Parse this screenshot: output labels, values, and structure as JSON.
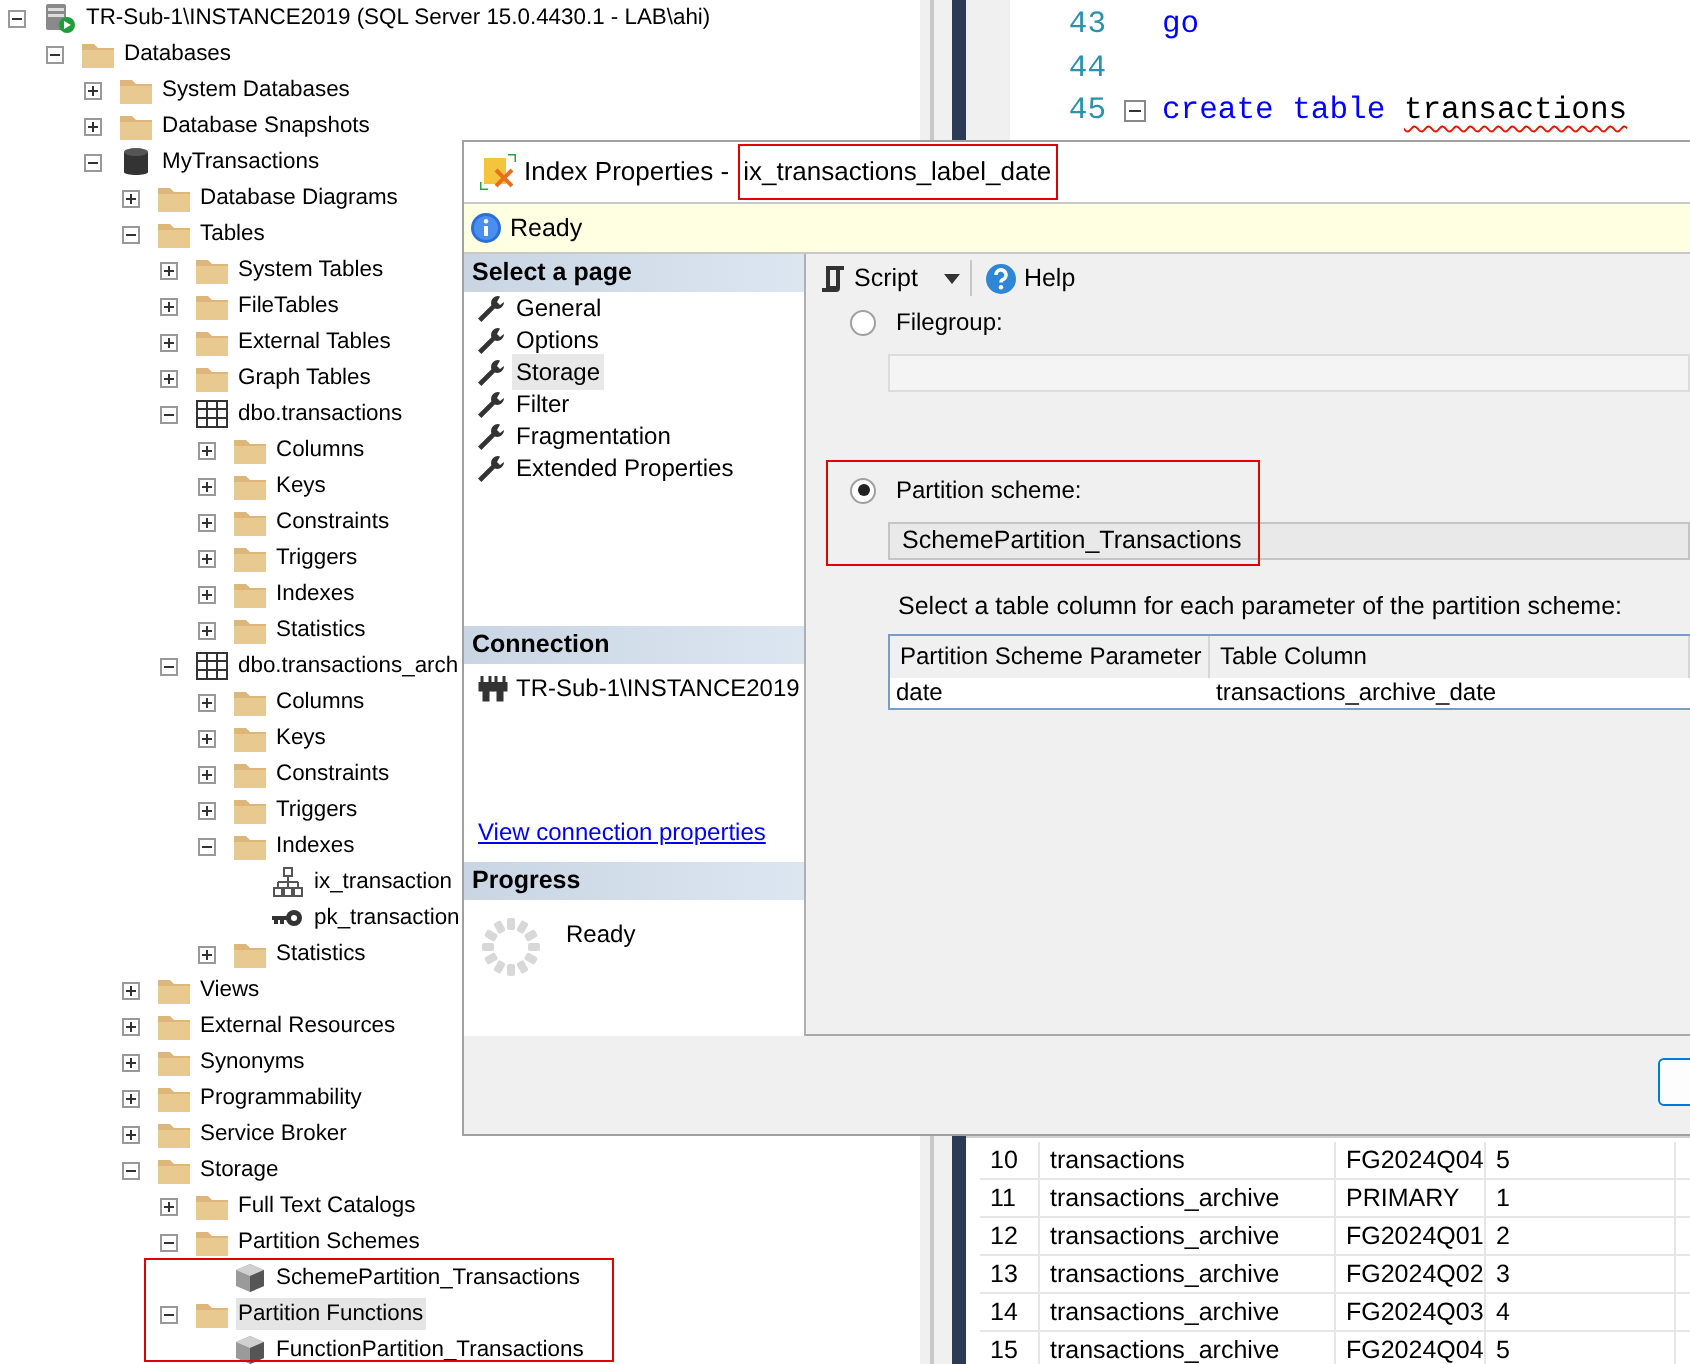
{
  "explorer": {
    "tree": [
      {
        "label": "TR-Sub-1\\INSTANCE2019 (SQL Server 15.0.4430.1 - LAB\\ahi)",
        "kind": "server",
        "expanded": true,
        "children": [
          {
            "label": "Databases",
            "kind": "folder",
            "expanded": true,
            "children": [
              {
                "label": "System Databases",
                "kind": "folder",
                "expanded": false
              },
              {
                "label": "Database Snapshots",
                "kind": "folder",
                "expanded": false
              },
              {
                "label": "MyTransactions",
                "kind": "database",
                "expanded": true,
                "children": [
                  {
                    "label": "Database Diagrams",
                    "kind": "folder",
                    "expanded": false
                  },
                  {
                    "label": "Tables",
                    "kind": "folder",
                    "expanded": true,
                    "children": [
                      {
                        "label": "System Tables",
                        "kind": "folder",
                        "expanded": false
                      },
                      {
                        "label": "FileTables",
                        "kind": "folder",
                        "expanded": false
                      },
                      {
                        "label": "External Tables",
                        "kind": "folder",
                        "expanded": false
                      },
                      {
                        "label": "Graph Tables",
                        "kind": "folder",
                        "expanded": false
                      },
                      {
                        "label": "dbo.transactions",
                        "kind": "table",
                        "expanded": true,
                        "children": [
                          {
                            "label": "Columns",
                            "kind": "folder",
                            "expanded": false
                          },
                          {
                            "label": "Keys",
                            "kind": "folder",
                            "expanded": false
                          },
                          {
                            "label": "Constraints",
                            "kind": "folder",
                            "expanded": false
                          },
                          {
                            "label": "Triggers",
                            "kind": "folder",
                            "expanded": false
                          },
                          {
                            "label": "Indexes",
                            "kind": "folder",
                            "expanded": false
                          },
                          {
                            "label": "Statistics",
                            "kind": "folder",
                            "expanded": false
                          }
                        ]
                      },
                      {
                        "label": "dbo.transactions_arch",
                        "kind": "table",
                        "expanded": true,
                        "children": [
                          {
                            "label": "Columns",
                            "kind": "folder",
                            "expanded": false
                          },
                          {
                            "label": "Keys",
                            "kind": "folder",
                            "expanded": false
                          },
                          {
                            "label": "Constraints",
                            "kind": "folder",
                            "expanded": false
                          },
                          {
                            "label": "Triggers",
                            "kind": "folder",
                            "expanded": false
                          },
                          {
                            "label": "Indexes",
                            "kind": "folder",
                            "expanded": true,
                            "children": [
                              {
                                "label": "ix_transaction",
                                "kind": "index"
                              },
                              {
                                "label": "pk_transaction",
                                "kind": "key"
                              }
                            ]
                          },
                          {
                            "label": "Statistics",
                            "kind": "folder",
                            "expanded": false
                          }
                        ]
                      }
                    ]
                  },
                  {
                    "label": "Views",
                    "kind": "folder",
                    "expanded": false
                  },
                  {
                    "label": "External Resources",
                    "kind": "folder",
                    "expanded": false
                  },
                  {
                    "label": "Synonyms",
                    "kind": "folder",
                    "expanded": false
                  },
                  {
                    "label": "Programmability",
                    "kind": "folder",
                    "expanded": false
                  },
                  {
                    "label": "Service Broker",
                    "kind": "folder",
                    "expanded": false
                  },
                  {
                    "label": "Storage",
                    "kind": "folder",
                    "expanded": true,
                    "children": [
                      {
                        "label": "Full Text Catalogs",
                        "kind": "folder",
                        "expanded": false
                      },
                      {
                        "label": "Partition Schemes",
                        "kind": "folder",
                        "expanded": true,
                        "children": [
                          {
                            "label": "SchemePartition_Transactions",
                            "kind": "partition",
                            "outlined": true
                          }
                        ]
                      },
                      {
                        "label": "Partition Functions",
                        "kind": "folder",
                        "expanded": true,
                        "selected": true,
                        "outlined": true,
                        "children": [
                          {
                            "label": "FunctionPartition_Transactions",
                            "kind": "partition",
                            "outlined": true
                          }
                        ]
                      }
                    ]
                  }
                ]
              }
            ]
          }
        ]
      }
    ]
  },
  "editor": {
    "lines": [
      {
        "number": "43",
        "tokens": [
          {
            "text": "go",
            "kind": "keyword"
          }
        ]
      },
      {
        "number": "44"
      },
      {
        "number": "45",
        "foldable": true,
        "tokens": [
          {
            "text": "create",
            "kind": "keyword"
          },
          {
            "text": "table",
            "kind": "keyword"
          },
          {
            "text": "transactions",
            "kind": "error"
          }
        ]
      }
    ]
  },
  "results": {
    "rows": [
      [
        "10",
        "transactions",
        "FG2024Q04",
        "5"
      ],
      [
        "11",
        "transactions_archive",
        "PRIMARY",
        "1"
      ],
      [
        "12",
        "transactions_archive",
        "FG2024Q01",
        "2"
      ],
      [
        "13",
        "transactions_archive",
        "FG2024Q02",
        "3"
      ],
      [
        "14",
        "transactions_archive",
        "FG2024Q03",
        "4"
      ],
      [
        "15",
        "transactions_archive",
        "FG2024Q04",
        "5"
      ]
    ]
  },
  "dialog": {
    "title": "Index Properties -",
    "object_name": {
      "text": "ix_transactions_label_date",
      "outlined": true
    },
    "status": "Ready",
    "select_page": {
      "heading": "Select a page",
      "items": [
        {
          "label": "General",
          "selected": false
        },
        {
          "label": "Options",
          "selected": false
        },
        {
          "label": "Storage",
          "selected": true
        },
        {
          "label": "Filter",
          "selected": false
        },
        {
          "label": "Fragmentation",
          "selected": false
        },
        {
          "label": "Extended Properties",
          "selected": false
        }
      ]
    },
    "connection": {
      "heading": "Connection",
      "server": "TR-Sub-1\\INSTANCE2019",
      "link": "View connection properties"
    },
    "progress": {
      "heading": "Progress",
      "status": "Ready"
    },
    "toolbar": {
      "script": "Script",
      "help": "Help"
    },
    "storage_options": [
      {
        "label": "Filegroup:",
        "selected": false
      },
      {
        "label": "Partition scheme:",
        "selected": true,
        "value": "SchemePartition_Transactions",
        "outlined": true
      }
    ],
    "mapping": {
      "caption": "Select a table column for each parameter of the partition scheme:",
      "columns": [
        "Partition Scheme Parameter",
        "Table Column"
      ],
      "rows": [
        [
          "date",
          "transactions_archive_date"
        ]
      ]
    }
  }
}
